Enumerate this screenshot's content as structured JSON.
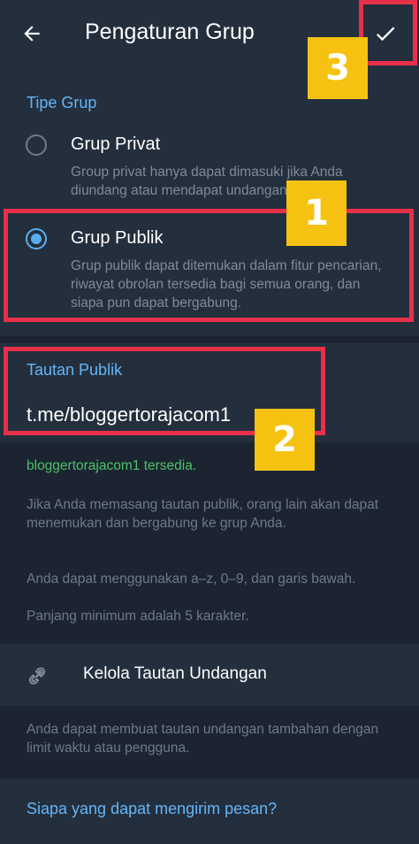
{
  "header": {
    "title": "Pengaturan Grup"
  },
  "group_type": {
    "section_label": "Tipe Grup",
    "options": [
      {
        "title": "Grup Privat",
        "description": "Group privat hanya dapat dimasuki jika Anda diundang atau mendapat undangan...",
        "selected": false
      },
      {
        "title": "Grup Publik",
        "description": "Grup publik dapat ditemukan dalam fitur pencarian, riwayat obrolan tersedia bagi semua orang, dan siapa pun dapat bergabung.",
        "selected": true
      }
    ]
  },
  "public_link": {
    "section_label": "Tautan Publik",
    "value": "t.me/bloggertorajacom1",
    "availability": "bloggertorajacom1 tersedia.",
    "info_1": "Jika Anda memasang tautan publik, orang lain akan dapat menemukan dan bergabung ke grup Anda.",
    "info_2": "Anda dapat menggunakan a–z, 0–9, dan garis bawah.",
    "info_3": "Panjang minimum adalah 5 karakter."
  },
  "invite": {
    "label": "Kelola Tautan Undangan",
    "info": "Anda dapat membuat tautan undangan tambahan dengan limit waktu atau pengguna."
  },
  "who_can_send": {
    "section_label": "Siapa yang dapat mengirim pesan?"
  },
  "annotations": {
    "badge_1": "1",
    "badge_2": "2",
    "badge_3": "3",
    "highlight_color": "#e8304a",
    "badge_color": "#f6c211"
  },
  "colors": {
    "accent": "#64b5f6",
    "available": "#4cc26a",
    "background": "#1d2733",
    "surface": "#242f3d"
  },
  "icons": {
    "back": "arrow-left-icon",
    "confirm": "check-icon",
    "link": "link-icon"
  }
}
